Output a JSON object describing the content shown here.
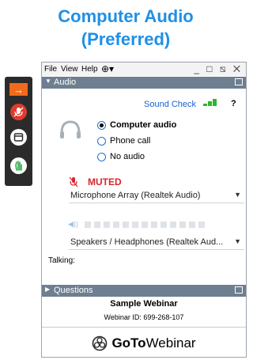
{
  "headline": [
    "Computer Audio",
    "(Preferred)"
  ],
  "menu": [
    "File",
    "View",
    "Help"
  ],
  "window_controls": "_ □ ⧅ ✕",
  "audio_section": {
    "title": "Audio",
    "sound_check": "Sound Check",
    "help": "?",
    "options": [
      {
        "label": "Computer audio",
        "selected": true
      },
      {
        "label": "Phone call",
        "selected": false
      },
      {
        "label": "No audio",
        "selected": false
      }
    ],
    "mute_status": "MUTED",
    "microphone": "Microphone Array (Realtek Audio)",
    "speakers": "Speakers / Headphones (Realtek Aud...",
    "talking_label": "Talking:"
  },
  "questions_section": {
    "title": "Questions"
  },
  "webinar": {
    "title": "Sample Webinar",
    "id_line": "Webinar ID: 699-268-107"
  },
  "brand": {
    "bold": "GoTo",
    "light": "Webinar"
  },
  "colors": {
    "accent": "#1e90e8",
    "section_bar": "#6d7f90",
    "muted": "#d9262c",
    "meter": "#2fb52f",
    "toolbar": "#2b2b2b",
    "orange": "#f26a1b"
  }
}
